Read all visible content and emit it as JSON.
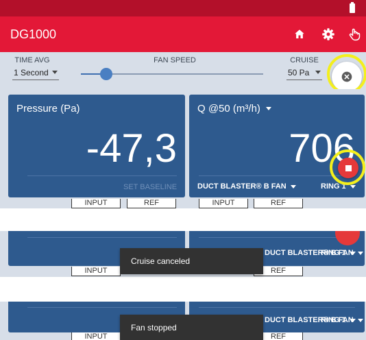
{
  "app": {
    "title": "DG1000"
  },
  "icons": {
    "battery": "battery-icon",
    "home": "home-icon",
    "settings": "gear-icon",
    "hand": "hand-touch-icon",
    "cancel": "close-circle-icon",
    "stop": "stop-icon"
  },
  "controls": {
    "time_avg": {
      "label": "TIME AVG",
      "value": "1 Second"
    },
    "fan_speed": {
      "label": "FAN SPEED",
      "level": 0.14
    },
    "cruise": {
      "label": "CRUISE",
      "value": "50 Pa"
    }
  },
  "tiles": {
    "left": {
      "title": "Pressure (Pa)",
      "value": "-47,3",
      "baseline": "SET BASELINE"
    },
    "right": {
      "title": "Q @50 (m³/h)",
      "value": "706",
      "device": "DUCT BLASTER® B FAN",
      "ring": "RING 1"
    }
  },
  "tabs": {
    "input": "INPUT",
    "ref": "REF"
  },
  "snackbars": {
    "first": "Cruise canceled",
    "second": "Fan stopped"
  },
  "colors": {
    "status_bar": "#b3102a",
    "app_bar": "#e31837",
    "tile": "#2e5a8e",
    "controls_bg": "#d7dee8",
    "highlight": "#f4ef1c",
    "fab": "#e5393a"
  }
}
